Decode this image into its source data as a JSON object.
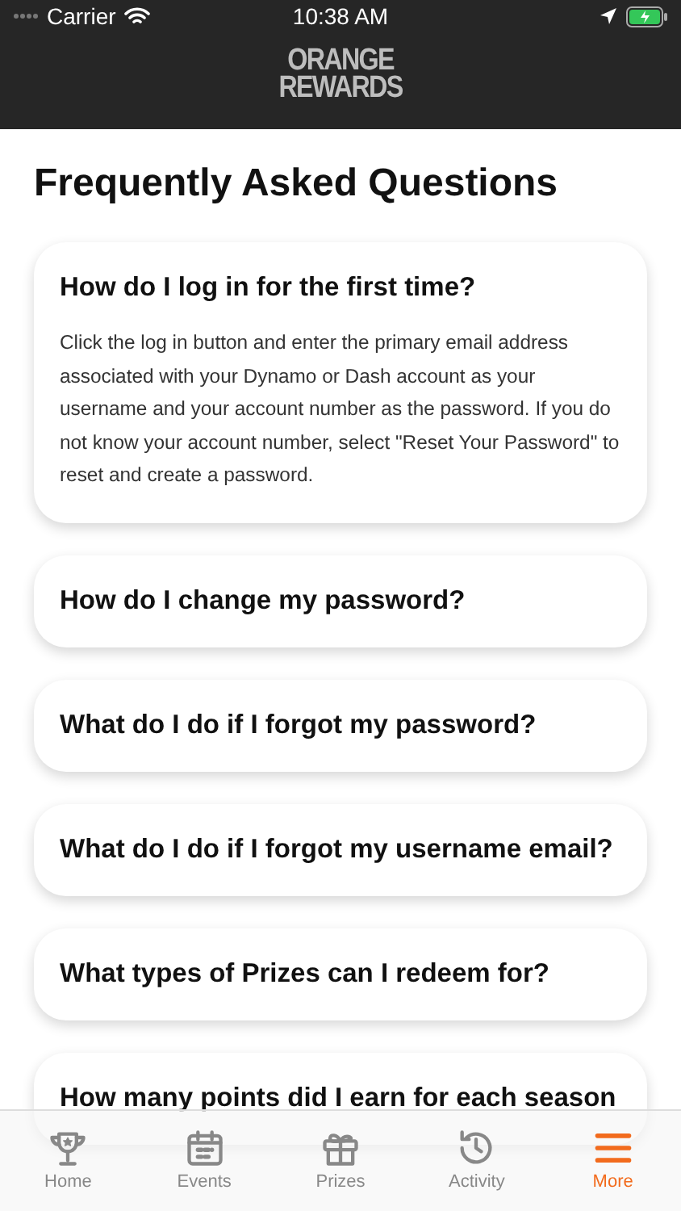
{
  "status_bar": {
    "carrier": "Carrier",
    "time": "10:38 AM"
  },
  "header": {
    "logo_lines": [
      "ORANGE",
      "REWARDS"
    ]
  },
  "title": "Frequently Asked Questions",
  "faqs": [
    {
      "question": "How do I log in for the first time?",
      "expanded": true,
      "answer": "Click the log in button and enter the primary email address associated with your Dynamo or Dash account as your username and your account number as the password.  If you do not know your account number, select \"Reset Your Password\" to reset and create a password."
    },
    {
      "question": "How do I change my password?",
      "expanded": false
    },
    {
      "question": "What do I do if I forgot my password?",
      "expanded": false
    },
    {
      "question": "What do I do if I forgot my username email?",
      "expanded": false
    },
    {
      "question": "What types of Prizes can I redeem for?",
      "expanded": false
    },
    {
      "question": "How many points did I earn for each season",
      "expanded": false
    }
  ],
  "tabs": [
    {
      "label": "Home",
      "kind": "trophy",
      "selected": false
    },
    {
      "label": "Events",
      "kind": "calendar",
      "selected": false
    },
    {
      "label": "Prizes",
      "kind": "gift",
      "selected": false
    },
    {
      "label": "Activity",
      "kind": "history",
      "selected": false
    },
    {
      "label": "More",
      "kind": "menu",
      "selected": true
    }
  ]
}
